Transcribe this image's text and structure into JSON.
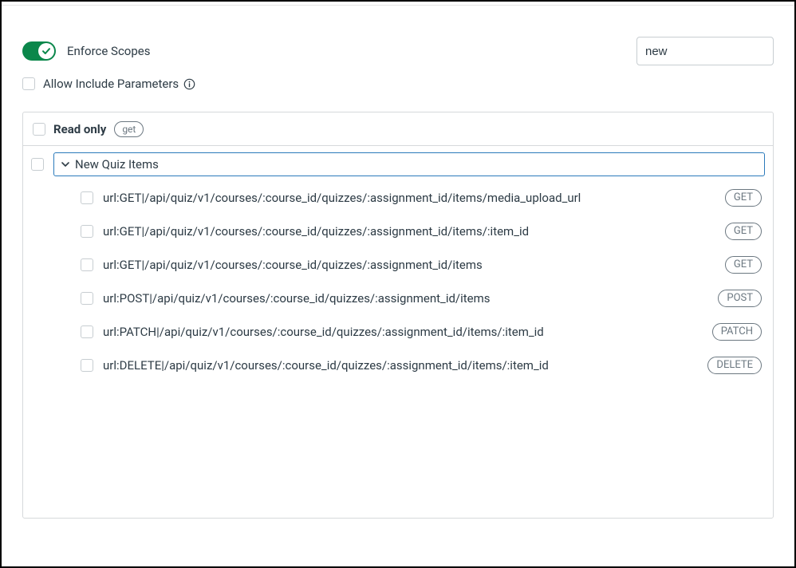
{
  "toggle": {
    "label": "Enforce Scopes",
    "on": true
  },
  "search": {
    "value": "new"
  },
  "allow_includes": {
    "label": "Allow Include Parameters"
  },
  "readonly": {
    "label": "Read only",
    "badge": "get"
  },
  "group": {
    "title": "New Quiz Items"
  },
  "endpoints": [
    {
      "url": "url:GET|/api/quiz/v1/courses/:course_id/quizzes/:assignment_id/items/media_upload_url",
      "method": "GET"
    },
    {
      "url": "url:GET|/api/quiz/v1/courses/:course_id/quizzes/:assignment_id/items/:item_id",
      "method": "GET"
    },
    {
      "url": "url:GET|/api/quiz/v1/courses/:course_id/quizzes/:assignment_id/items",
      "method": "GET"
    },
    {
      "url": "url:POST|/api/quiz/v1/courses/:course_id/quizzes/:assignment_id/items",
      "method": "POST"
    },
    {
      "url": "url:PATCH|/api/quiz/v1/courses/:course_id/quizzes/:assignment_id/items/:item_id",
      "method": "PATCH"
    },
    {
      "url": "url:DELETE|/api/quiz/v1/courses/:course_id/quizzes/:assignment_id/items/:item_id",
      "method": "DELETE"
    }
  ]
}
